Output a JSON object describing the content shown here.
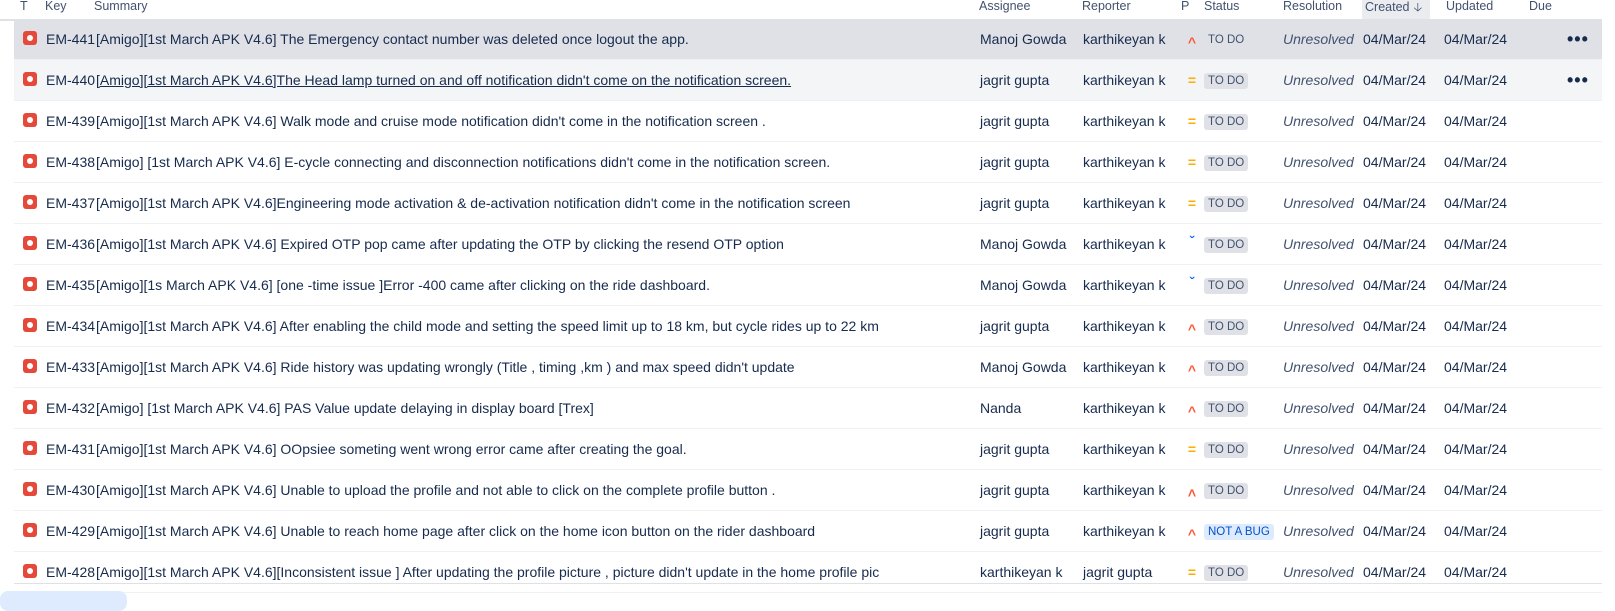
{
  "columns": {
    "type": "T",
    "key": "Key",
    "summary": "Summary",
    "assignee": "Assignee",
    "reporter": "Reporter",
    "priority": "P",
    "status": "Status",
    "resolution": "Resolution",
    "created": "Created",
    "updated": "Updated",
    "due": "Due"
  },
  "sort_icon": "arrow-down-icon",
  "rows": [
    {
      "key": "EM-441",
      "summary": "[Amigo][1st March APK V4.6] The Emergency contact number was deleted once logout the app.",
      "assignee": "Manoj Gowda",
      "reporter": "karthikeyan k",
      "priority": "high",
      "status": "TO DO",
      "resolution": "Unresolved",
      "created": "04/Mar/24",
      "updated": "04/Mar/24"
    },
    {
      "key": "EM-440",
      "summary": "[Amigo][1st March APK V4.6]The Head lamp turned on and off notification didn't come on the notification screen.",
      "assignee": "jagrit gupta",
      "reporter": "karthikeyan k",
      "priority": "medium",
      "status": "TO DO",
      "resolution": "Unresolved",
      "created": "04/Mar/24",
      "updated": "04/Mar/24"
    },
    {
      "key": "EM-439",
      "summary": "[Amigo][1st March APK V4.6] Walk mode and cruise mode notification didn't come in the notification screen .",
      "assignee": "jagrit gupta",
      "reporter": "karthikeyan k",
      "priority": "medium",
      "status": "TO DO",
      "resolution": "Unresolved",
      "created": "04/Mar/24",
      "updated": "04/Mar/24"
    },
    {
      "key": "EM-438",
      "summary": "[Amigo] [1st March APK V4.6] E-cycle connecting and disconnection notifications didn't come in the notification screen.",
      "assignee": "jagrit gupta",
      "reporter": "karthikeyan k",
      "priority": "medium",
      "status": "TO DO",
      "resolution": "Unresolved",
      "created": "04/Mar/24",
      "updated": "04/Mar/24"
    },
    {
      "key": "EM-437",
      "summary": "[Amigo][1st March APK V4.6]Engineering mode activation & de-activation notification didn't come in the notification screen",
      "assignee": "jagrit gupta",
      "reporter": "karthikeyan k",
      "priority": "medium",
      "status": "TO DO",
      "resolution": "Unresolved",
      "created": "04/Mar/24",
      "updated": "04/Mar/24"
    },
    {
      "key": "EM-436",
      "summary": "[Amigo][1st March APK V4.6] Expired OTP pop came after updating the OTP by clicking the resend OTP option",
      "assignee": "Manoj Gowda",
      "reporter": "karthikeyan k",
      "priority": "low",
      "status": "TO DO",
      "resolution": "Unresolved",
      "created": "04/Mar/24",
      "updated": "04/Mar/24"
    },
    {
      "key": "EM-435",
      "summary": "[Amigo][1s March APK V4.6] [one -time issue ]Error -400 came after clicking on the ride dashboard.",
      "assignee": "Manoj Gowda",
      "reporter": "karthikeyan k",
      "priority": "low",
      "status": "TO DO",
      "resolution": "Unresolved",
      "created": "04/Mar/24",
      "updated": "04/Mar/24"
    },
    {
      "key": "EM-434",
      "summary": "[Amigo][1st March APK V4.6] After enabling the child mode and setting the speed limit up to 18 km, but cycle rides up to 22 km",
      "assignee": "jagrit gupta",
      "reporter": "karthikeyan k",
      "priority": "high",
      "status": "TO DO",
      "resolution": "Unresolved",
      "created": "04/Mar/24",
      "updated": "04/Mar/24"
    },
    {
      "key": "EM-433",
      "summary": "[Amigo][1st March APK V4.6] Ride history was updating wrongly (Title , timing ,km ) and max speed didn't update",
      "assignee": "Manoj Gowda",
      "reporter": "karthikeyan k",
      "priority": "high",
      "status": "TO DO",
      "resolution": "Unresolved",
      "created": "04/Mar/24",
      "updated": "04/Mar/24"
    },
    {
      "key": "EM-432",
      "summary": "[Amigo] [1st March APK V4.6] PAS Value update delaying in display board [Trex]",
      "assignee": "Nanda",
      "reporter": "karthikeyan k",
      "priority": "high",
      "status": "TO DO",
      "resolution": "Unresolved",
      "created": "04/Mar/24",
      "updated": "04/Mar/24"
    },
    {
      "key": "EM-431",
      "summary": "[Amigo][1st March APK V4.6] OOpsiee someting went wrong error came after creating the goal.",
      "assignee": "jagrit gupta",
      "reporter": "karthikeyan k",
      "priority": "medium",
      "status": "TO DO",
      "resolution": "Unresolved",
      "created": "04/Mar/24",
      "updated": "04/Mar/24"
    },
    {
      "key": "EM-430",
      "summary": "[Amigo][1st March APK V4.6] Unable to upload the profile and not able to click on the complete profile button .",
      "assignee": "jagrit gupta",
      "reporter": "karthikeyan k",
      "priority": "highest",
      "status": "TO DO",
      "resolution": "Unresolved",
      "created": "04/Mar/24",
      "updated": "04/Mar/24"
    },
    {
      "key": "EM-429",
      "summary": "[Amigo][1st March APK V4.6] Unable to reach home page after click on the home icon button on the rider dashboard",
      "assignee": "jagrit gupta",
      "reporter": "karthikeyan k",
      "priority": "high",
      "status": "NOT A BUG",
      "resolution": "Unresolved",
      "created": "04/Mar/24",
      "updated": "04/Mar/24"
    },
    {
      "key": "EM-428",
      "summary": "[Amigo][1st March APK V4.6][Inconsistent issue ] After updating the profile picture , picture didn't update in the home profile pic",
      "assignee": "karthikeyan k",
      "reporter": "jagrit gupta",
      "priority": "medium",
      "status": "TO DO",
      "resolution": "Unresolved",
      "created": "04/Mar/24",
      "updated": "04/Mar/24"
    }
  ],
  "priority_glyphs": {
    "high": "^",
    "medium": "=",
    "low": "ˇ",
    "highest": "˄"
  },
  "more_glyph": "•••",
  "colors": {
    "bug": "#e5493a",
    "selected_row": "#dfe1e6",
    "blue_lozenge": "#deebff"
  }
}
